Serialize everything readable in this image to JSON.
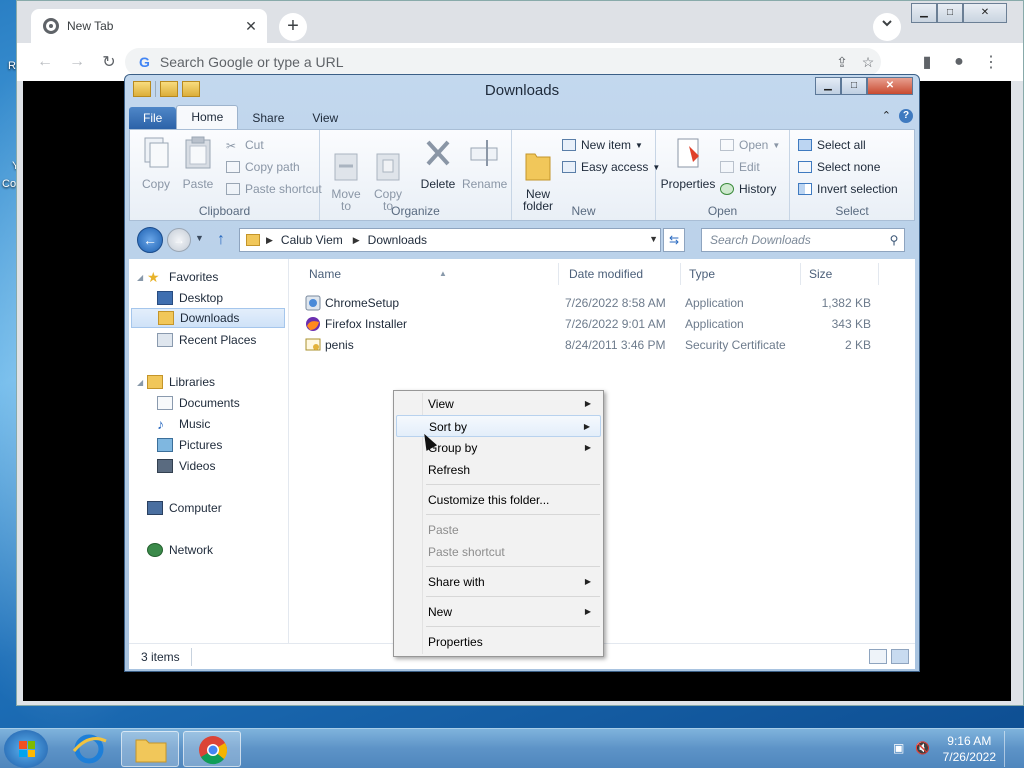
{
  "desktop": {
    "labels": [
      "R",
      "Y",
      "Co"
    ]
  },
  "chrome": {
    "tab_title": "New Tab",
    "tab_close": "✕",
    "new_tab": "+",
    "omnibox_placeholder": "Search Google or type a URL",
    "google_g": "G",
    "controls": {
      "minimize": "▁",
      "maximize": "□",
      "close": "✕"
    }
  },
  "explorer": {
    "title": "Downloads",
    "ribbon_tabs": [
      "File",
      "Home",
      "Share",
      "View"
    ],
    "clipboard": {
      "copy": "Copy",
      "paste": "Paste",
      "cut": "Cut",
      "copy_path": "Copy path",
      "paste_shortcut": "Paste shortcut",
      "group": "Clipboard"
    },
    "organize": {
      "move_to": "Move\nto",
      "copy_to": "Copy\nto",
      "delete": "Delete",
      "rename": "Rename",
      "group": "Organize"
    },
    "new_group": {
      "new_folder": "New\nfolder",
      "new_item": "New item",
      "easy_access": "Easy access",
      "group": "New"
    },
    "open_group": {
      "properties": "Properties",
      "open": "Open",
      "edit": "Edit",
      "history": "History",
      "group": "Open"
    },
    "select_group": {
      "select_all": "Select all",
      "select_none": "Select none",
      "invert": "Invert selection",
      "group": "Select"
    },
    "breadcrumb": [
      "Calub Viem",
      "Downloads"
    ],
    "search_placeholder": "Search Downloads",
    "nav": {
      "favorites": "Favorites",
      "desktop": "Desktop",
      "downloads": "Downloads",
      "recent": "Recent Places",
      "libraries": "Libraries",
      "documents": "Documents",
      "music": "Music",
      "pictures": "Pictures",
      "videos": "Videos",
      "computer": "Computer",
      "network": "Network"
    },
    "columns": [
      "Name",
      "Date modified",
      "Type",
      "Size"
    ],
    "files": [
      {
        "name": "ChromeSetup",
        "date": "7/26/2022 8:58 AM",
        "type": "Application",
        "size": "1,382 KB",
        "icon": "installer-icon"
      },
      {
        "name": "Firefox Installer",
        "date": "7/26/2022 9:01 AM",
        "type": "Application",
        "size": "343 KB",
        "icon": "firefox-icon"
      },
      {
        "name": "penis",
        "date": "8/24/2011 3:46 PM",
        "type": "Security Certificate",
        "size": "2 KB",
        "icon": "certificate-icon"
      }
    ],
    "status": "3 items"
  },
  "context_menu": {
    "view": "View",
    "sort_by": "Sort by",
    "group_by": "Group by",
    "refresh": "Refresh",
    "customize": "Customize this folder...",
    "paste": "Paste",
    "paste_shortcut": "Paste shortcut",
    "share_with": "Share with",
    "new": "New",
    "properties": "Properties",
    "submenu_arrow": "▶"
  },
  "taskbar": {
    "time": "9:16 AM",
    "date": "7/26/2022"
  },
  "colors": {
    "accent": "#2c62a8",
    "chrome_bg": "#dee1e6",
    "taskbar": "#5d93c7"
  }
}
